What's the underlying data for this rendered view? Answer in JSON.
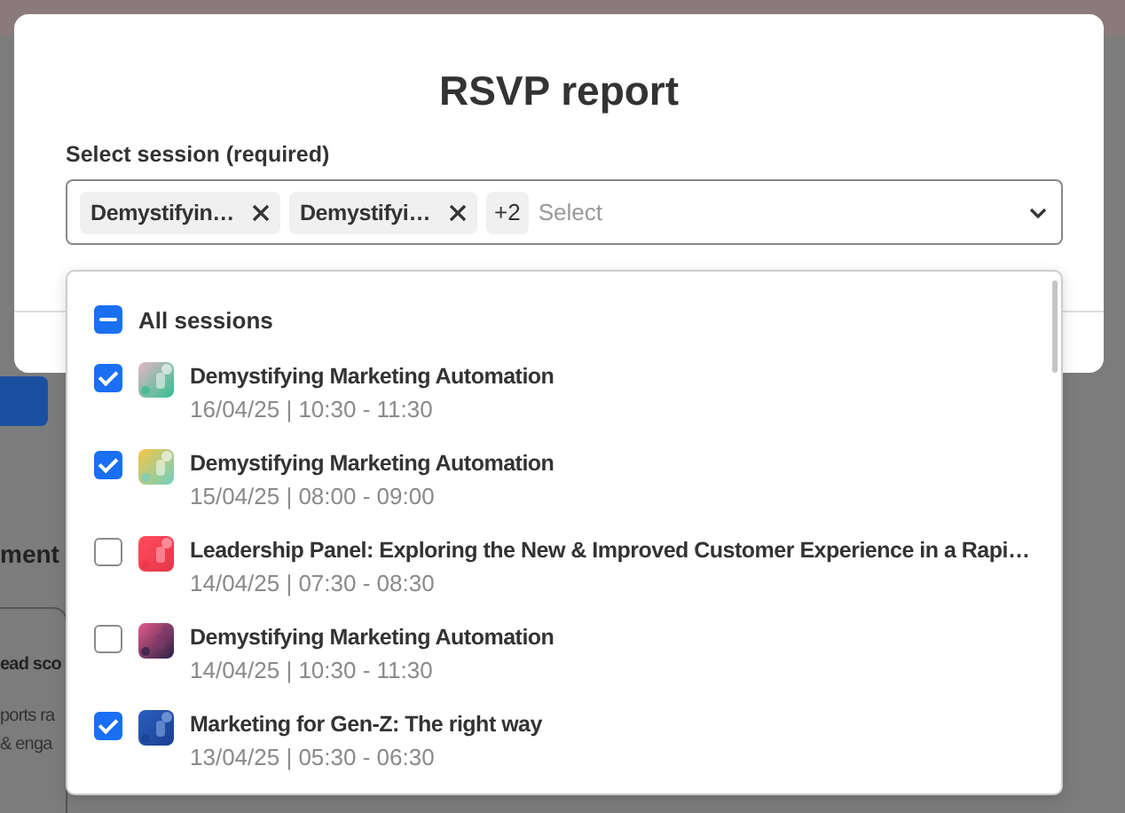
{
  "background": {
    "section_heading": "ment",
    "card_title": "ead sco",
    "card_text": [
      "ports ra",
      "& enga"
    ]
  },
  "modal": {
    "title": "RSVP report",
    "field_label": "Select session (required)",
    "chips": [
      {
        "label": "Demystifyin…"
      },
      {
        "label": "Demystifyi…"
      }
    ],
    "more_count": "+2",
    "placeholder": "Select",
    "all_sessions": {
      "label": "All sessions",
      "indeterminate": true
    },
    "sessions": [
      {
        "title": "Demystifying Marketing Automation",
        "time": "16/04/25 | 10:30 - 11:30",
        "checked": true
      },
      {
        "title": "Demystifying Marketing Automation",
        "time": "15/04/25 | 08:00 - 09:00",
        "checked": true
      },
      {
        "title": "Leadership Panel: Exploring the New & Improved Customer Experience in a Rapi…",
        "time": "14/04/25 | 07:30 - 08:30",
        "checked": false
      },
      {
        "title": "Demystifying Marketing Automation",
        "time": "14/04/25 | 10:30 - 11:30",
        "checked": false
      },
      {
        "title": "Marketing for Gen-Z: The right way",
        "time": "13/04/25 | 05:30 - 06:30",
        "checked": true
      }
    ]
  }
}
